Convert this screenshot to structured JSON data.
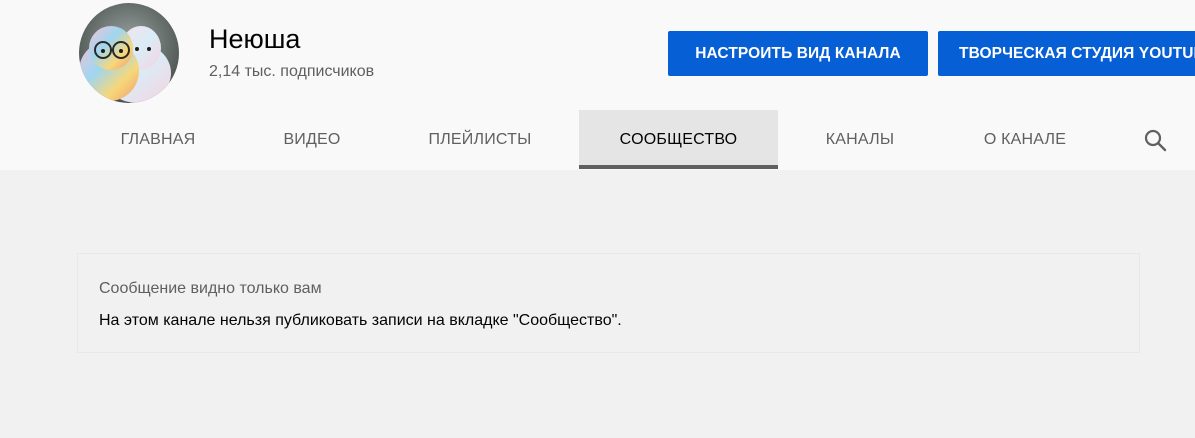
{
  "channel": {
    "name": "Неюша",
    "subscribers": "2,14 тыс. подписчиков"
  },
  "buttons": {
    "customize": "НАСТРОИТЬ ВИД КАНАЛА",
    "studio": "ТВОРЧЕСКАЯ СТУДИЯ YOUTUBE"
  },
  "tabs": [
    {
      "label": "ГЛАВНАЯ"
    },
    {
      "label": "ВИДЕО"
    },
    {
      "label": "ПЛЕЙЛИСТЫ"
    },
    {
      "label": "СООБЩЕСТВО",
      "active": true
    },
    {
      "label": "КАНАЛЫ"
    },
    {
      "label": "О КАНАЛЕ"
    }
  ],
  "icons": {
    "search": "search-icon"
  },
  "notice": {
    "title": "Сообщение видно только вам",
    "body": "На этом канале нельзя публиковать записи на вкладке \"Сообщество\"."
  },
  "colors": {
    "accent": "#065fd4",
    "header_bg": "#f9f9f9",
    "page_bg": "#f1f1f1",
    "active_tab_bg": "#e5e5e5",
    "active_tab_underline": "#606060"
  }
}
